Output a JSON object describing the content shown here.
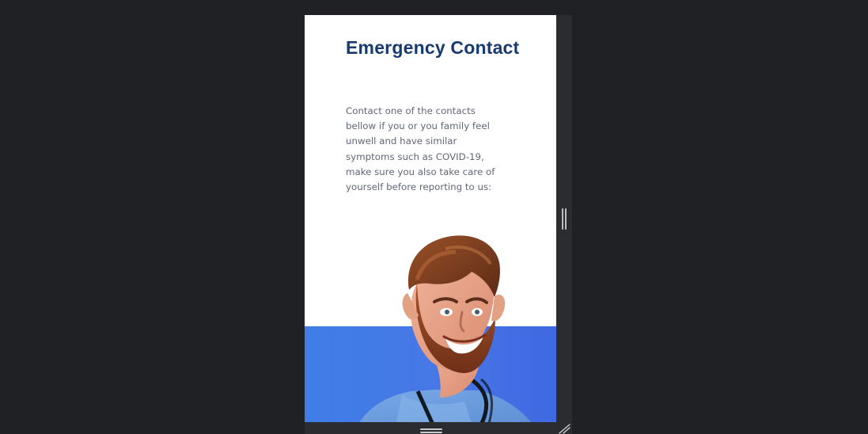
{
  "content": {
    "title": "Emergency Contact",
    "intro": "Contact one of the contacts bellow if you or you family feel unwell and have similar symptoms such as COVID-19, make sure you also take care of yourself before reporting to us:"
  },
  "icons": {
    "right_resize": "vertical-resize-grip-icon",
    "bottom_resize": "horizontal-resize-grip-icon",
    "corner_resize": "diagonal-resize-icon"
  },
  "colors": {
    "background": "#202124",
    "frame": "#ffffff",
    "title": "#173a73",
    "body_text": "#616778",
    "blue_band": "#4777e6",
    "resize_rail": "#2b2c2f"
  }
}
